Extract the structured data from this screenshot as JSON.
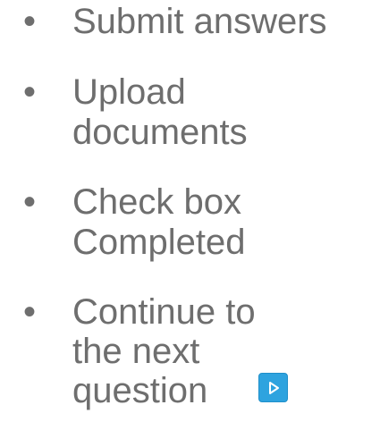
{
  "steps": [
    {
      "bullet": "•",
      "label": "Submit answers"
    },
    {
      "bullet": "•",
      "label": "Upload\ndocuments"
    },
    {
      "bullet": "•",
      "label": "Check box\nCompleted"
    },
    {
      "bullet": "•",
      "label": "Continue to\nthe next\nquestion"
    }
  ],
  "next_button": {
    "icon": "play-arrow-icon",
    "background": "#2ea3df",
    "icon_color": "#ffffff"
  },
  "colors": {
    "text": "#6e6e6e",
    "background": "#ffffff"
  }
}
